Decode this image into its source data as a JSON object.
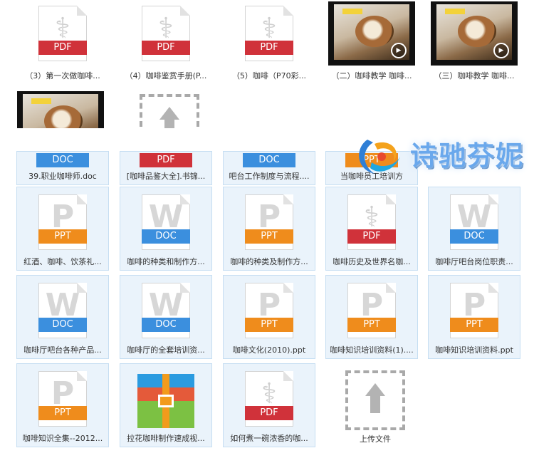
{
  "row1": [
    {
      "type": "pdf",
      "badge": "PDF",
      "label": "（3）第一次做咖啡..."
    },
    {
      "type": "pdf",
      "badge": "PDF",
      "label": "（4）咖啡鉴赏手册(P..."
    },
    {
      "type": "pdf",
      "badge": "PDF",
      "label": "（5）咖啡（P70彩..."
    },
    {
      "type": "video",
      "label": "（二）咖啡教学 咖啡..."
    },
    {
      "type": "video",
      "label": "（三）咖啡教学 咖啡..."
    }
  ],
  "row2": [
    {
      "type": "video",
      "label": ""
    },
    {
      "type": "upload",
      "label": ""
    }
  ],
  "row3": [
    {
      "type": "doc",
      "badge": "DOC",
      "label": "39.职业咖啡师.doc"
    },
    {
      "type": "pdf",
      "badge": "PDF",
      "label": "[咖啡品鉴大全].书锦..."
    },
    {
      "type": "doc",
      "badge": "DOC",
      "label": "吧台工作制度与流程...."
    },
    {
      "type": "ppt",
      "badge": "PPT",
      "label": "当咖啡员工培训方"
    }
  ],
  "row4": [
    {
      "type": "ppt",
      "badge": "PPT",
      "label": "红酒、咖啡、饮茶礼..."
    },
    {
      "type": "doc",
      "badge": "DOC",
      "label": "咖啡的种类和制作方..."
    },
    {
      "type": "ppt",
      "badge": "PPT",
      "label": "咖啡的种类及制作方..."
    },
    {
      "type": "pdf",
      "badge": "PDF",
      "label": "咖啡历史及世界名咖..."
    },
    {
      "type": "doc",
      "badge": "DOC",
      "label": "咖啡厅吧台岗位职责..."
    }
  ],
  "row5": [
    {
      "type": "doc",
      "badge": "DOC",
      "label": "咖啡厅吧台各种产品..."
    },
    {
      "type": "doc",
      "badge": "DOC",
      "label": "咖啡厅的全套培训资..."
    },
    {
      "type": "ppt",
      "badge": "PPT",
      "label": "咖啡文化(2010).ppt"
    },
    {
      "type": "ppt",
      "badge": "PPT",
      "label": "咖啡知识培训资料(1)...."
    },
    {
      "type": "ppt",
      "badge": "PPT",
      "label": "咖啡知识培训资料.ppt"
    }
  ],
  "row6": [
    {
      "type": "ppt",
      "badge": "PPT",
      "label": "咖啡知识全集--2012..."
    },
    {
      "type": "archive",
      "label": "拉花咖啡制作速成视..."
    },
    {
      "type": "pdf",
      "badge": "PDF",
      "label": "如何煮一碗浓香的咖..."
    },
    {
      "type": "upload",
      "label": "上传文件"
    }
  ],
  "watermark": {
    "text": "诗驰芬妮"
  },
  "colors": {
    "pdf": "#d0323a",
    "doc": "#3b8fde",
    "ppt": "#ef8c1c",
    "selection": "#eaf3fb"
  }
}
